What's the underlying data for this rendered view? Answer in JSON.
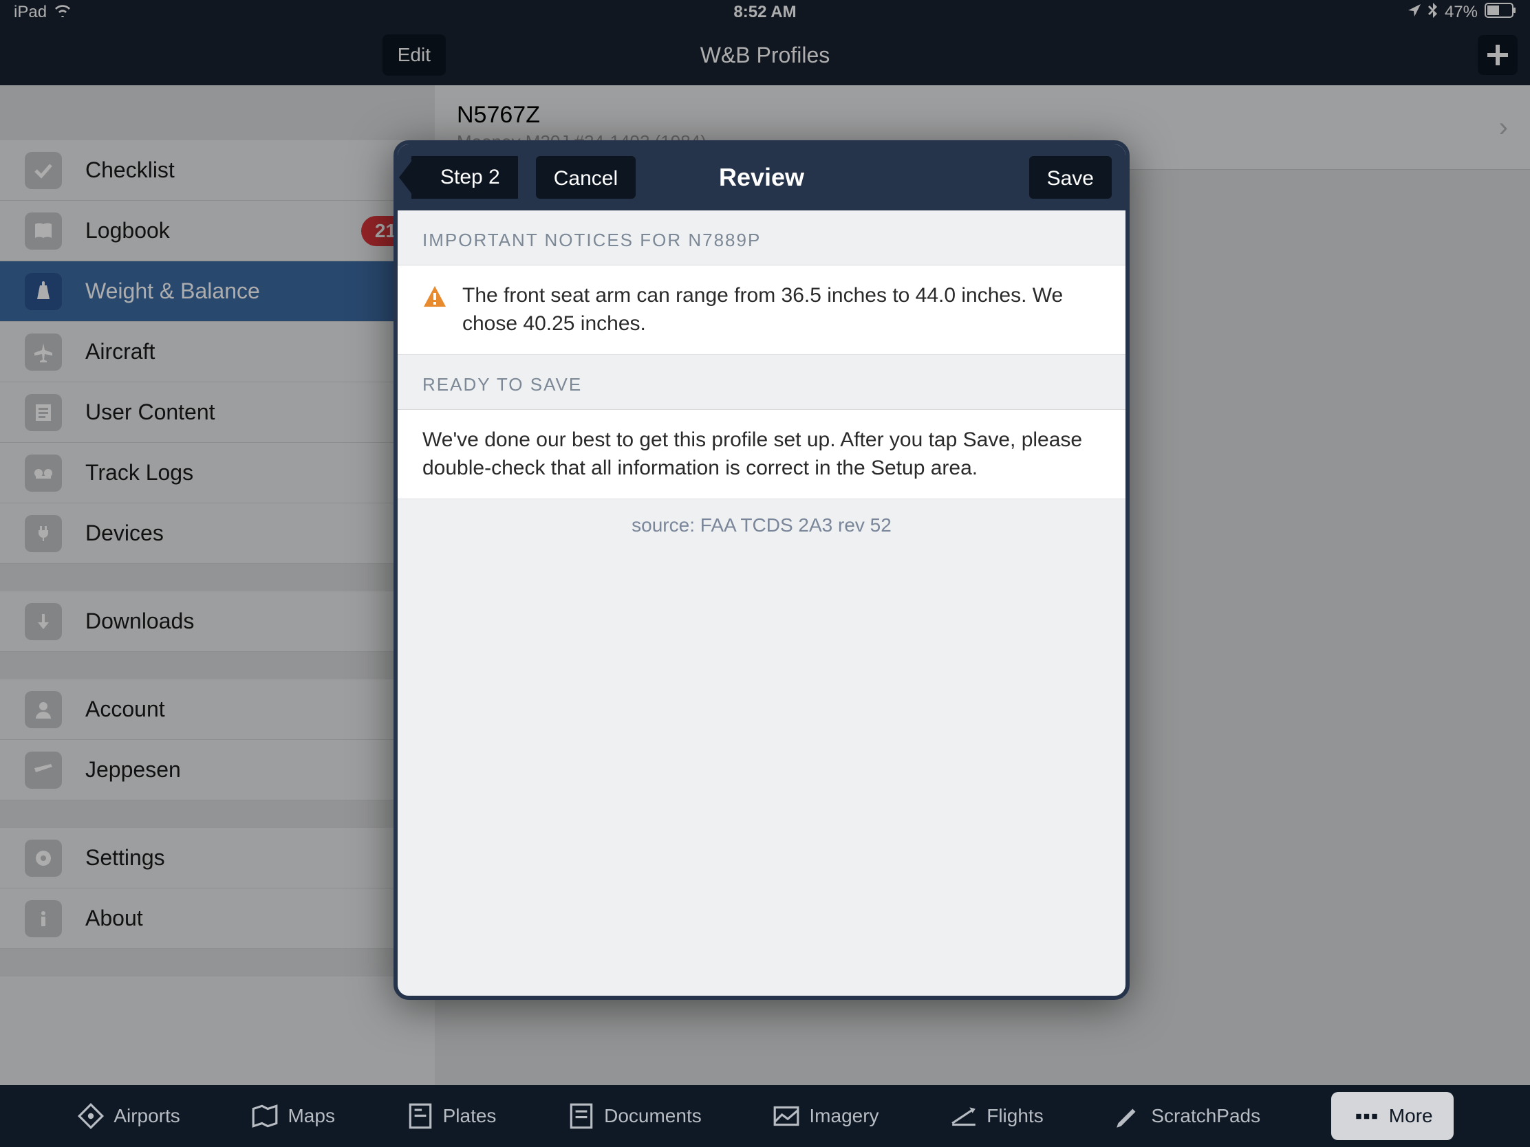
{
  "status": {
    "device": "iPad",
    "time": "8:52 AM",
    "battery": "47%"
  },
  "nav": {
    "edit": "Edit",
    "title": "W&B Profiles",
    "add": "+"
  },
  "sidebar": {
    "items": [
      {
        "label": "Checklist"
      },
      {
        "label": "Logbook",
        "badge": "21"
      },
      {
        "label": "Weight & Balance"
      },
      {
        "label": "Aircraft"
      },
      {
        "label": "User Content"
      },
      {
        "label": "Track Logs"
      },
      {
        "label": "Devices"
      },
      {
        "label": "Downloads"
      },
      {
        "label": "Account"
      },
      {
        "label": "Jeppesen"
      },
      {
        "label": "Settings"
      },
      {
        "label": "About"
      }
    ]
  },
  "detail": {
    "title": "N5767Z",
    "subtitle": "Mooney M20J #24-1492 (1984)"
  },
  "modal": {
    "back": "Step 2",
    "cancel": "Cancel",
    "title": "Review",
    "save": "Save",
    "section1": "IMPORTANT NOTICES FOR N7889P",
    "notice1": "The front seat arm can range from 36.5 inches to 44.0 inches. We chose 40.25 inches.",
    "section2": "READY TO SAVE",
    "ready": "We've done our best to get this profile set up. After you tap Save, please double-check that all information is correct in the Setup area.",
    "source": "source: FAA TCDS 2A3 rev 52"
  },
  "tabs": {
    "items": [
      {
        "label": "Airports"
      },
      {
        "label": "Maps"
      },
      {
        "label": "Plates"
      },
      {
        "label": "Documents"
      },
      {
        "label": "Imagery"
      },
      {
        "label": "Flights"
      },
      {
        "label": "ScratchPads"
      },
      {
        "label": "More"
      }
    ]
  }
}
